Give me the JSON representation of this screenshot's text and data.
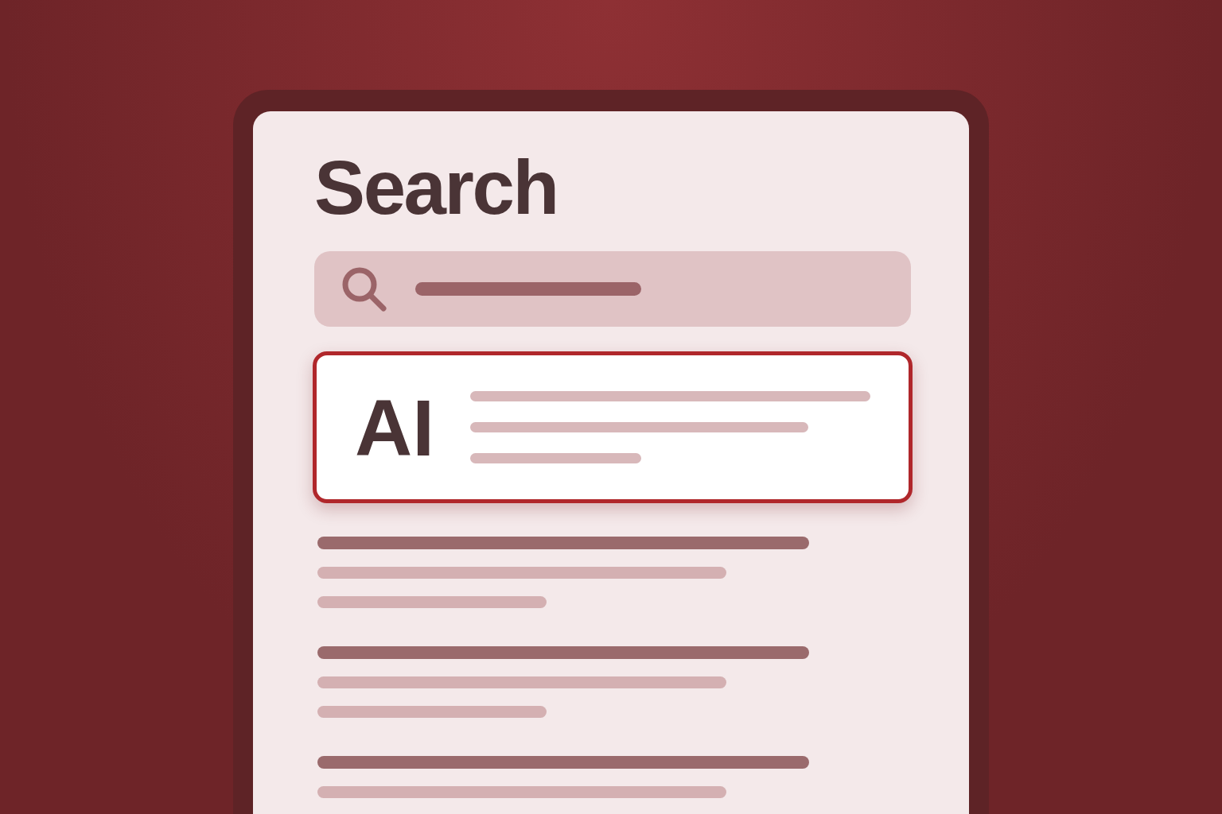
{
  "title": "Search",
  "highlighted_result": {
    "label": "AI",
    "selected": true
  }
}
